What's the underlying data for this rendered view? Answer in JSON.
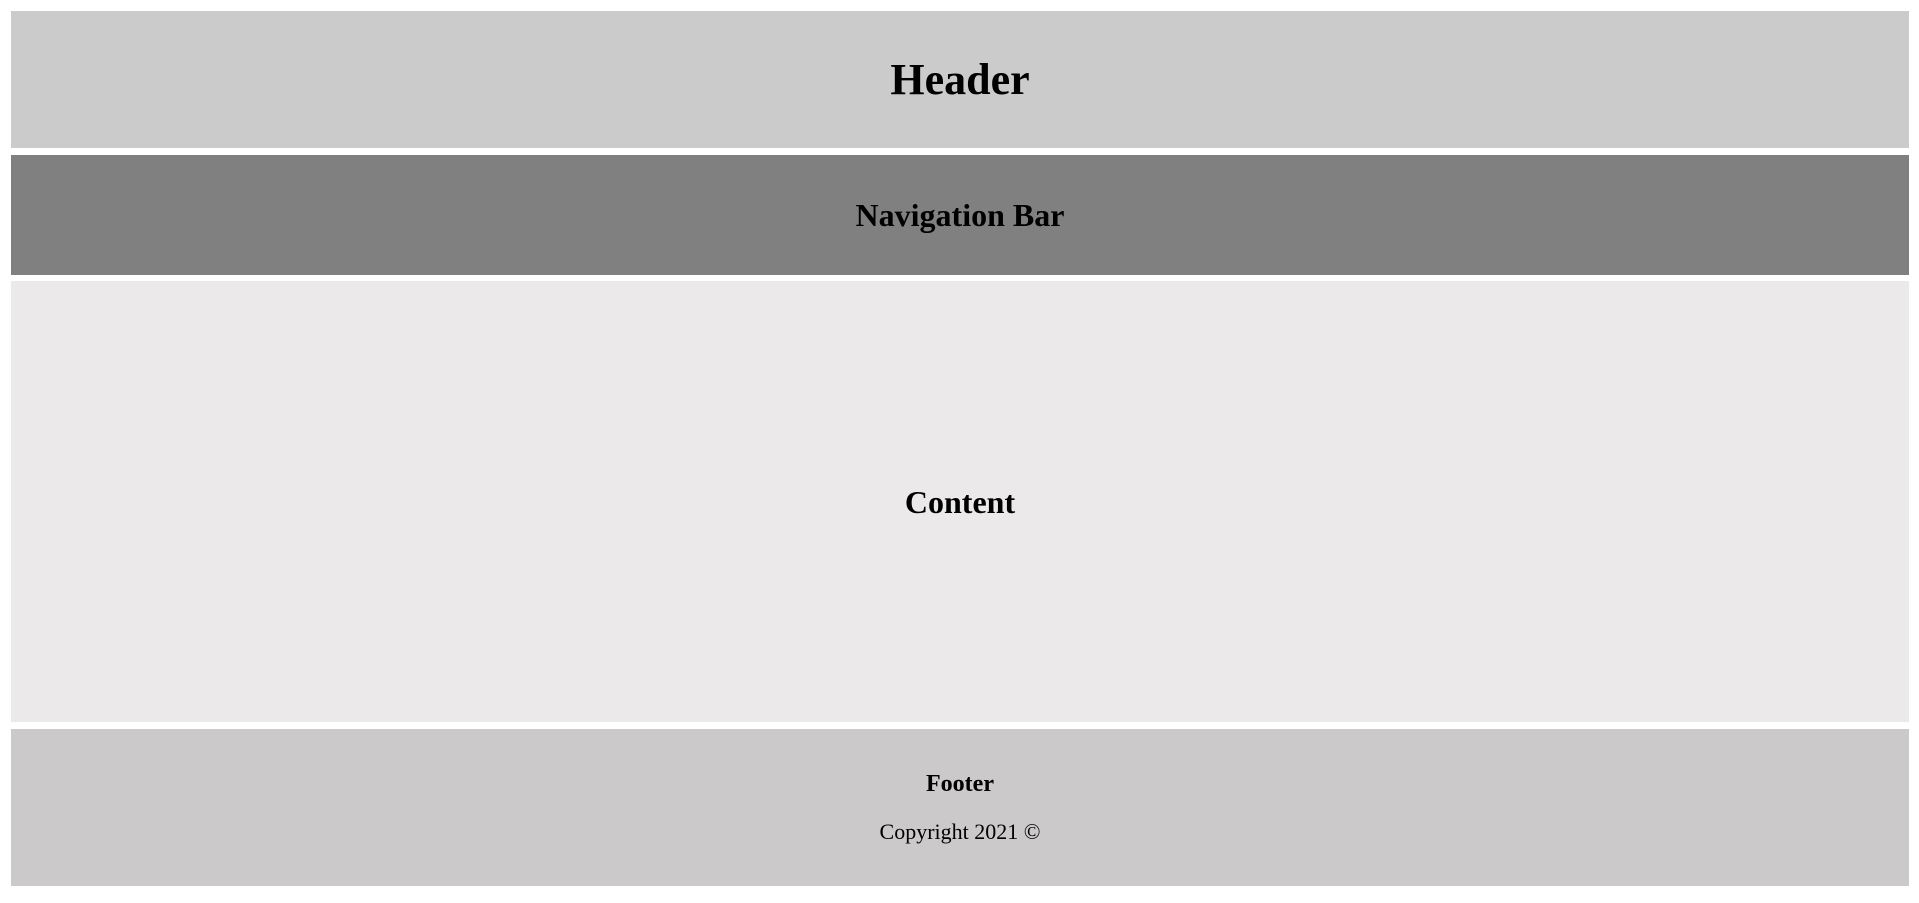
{
  "header": {
    "title": "Header",
    "background": "#cccbcb"
  },
  "navbar": {
    "title": "Navigation Bar",
    "background": "#808080"
  },
  "content": {
    "title": "Content",
    "background": "#ebe9ea"
  },
  "footer": {
    "title": "Footer",
    "copyright": "Copyright 2021 ©",
    "background": "#cbc9ca"
  }
}
